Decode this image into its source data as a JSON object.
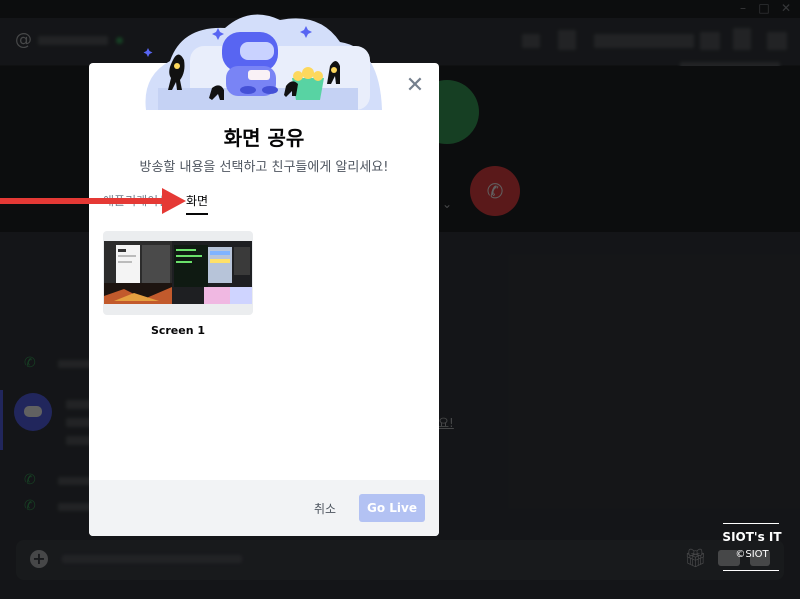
{
  "modal": {
    "title": "화면 공유",
    "subtitle": "방송할 내용을 선택하고 친구들에게 알리세요!",
    "tabs": [
      {
        "label": "애플리케이션",
        "active": false
      },
      {
        "label": "화면",
        "active": true
      }
    ],
    "screens": [
      {
        "label": "Screen 1"
      }
    ],
    "close_icon": "close-icon",
    "buttons": {
      "cancel": "취소",
      "go_live": "Go Live"
    }
  },
  "watermark": {
    "title": "SIOT's IT",
    "sub": "©SIOT"
  },
  "colors": {
    "accent": "#5865f2",
    "go_live_disabled": "#b3c2f3",
    "annotation_arrow": "#e53935",
    "voice_green": "#3ba55d",
    "hangup_red": "#ed4245"
  }
}
